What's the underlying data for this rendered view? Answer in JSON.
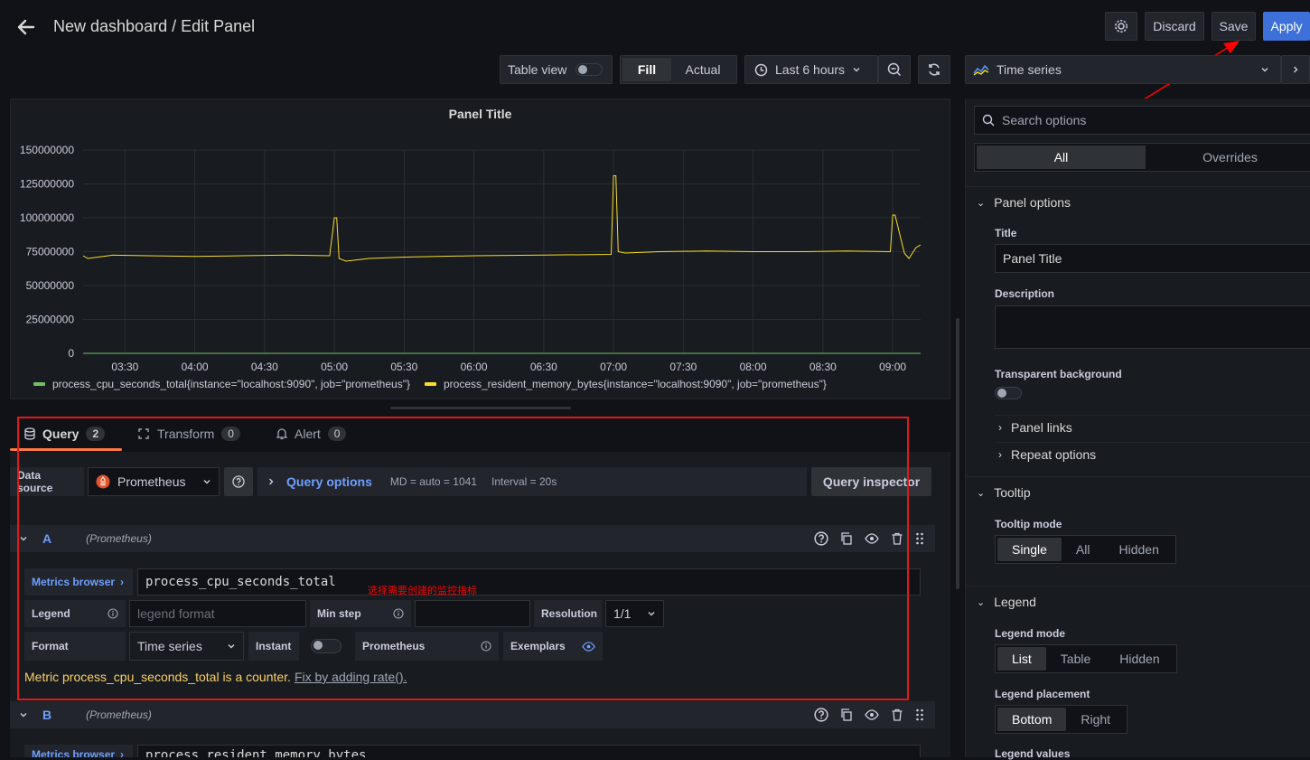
{
  "header": {
    "title": "New dashboard / Edit Panel",
    "discard": "Discard",
    "save": "Save",
    "apply": "Apply"
  },
  "toolbar": {
    "table_view": "Table view",
    "fill": "Fill",
    "actual": "Actual",
    "time_range": "Last 6 hours"
  },
  "panel": {
    "title": "Panel Title"
  },
  "chart_data": {
    "type": "line",
    "title": "",
    "yticks": [
      "150000000",
      "125000000",
      "100000000",
      "75000000",
      "50000000",
      "25000000",
      "0"
    ],
    "ylim": [
      0,
      150000000
    ],
    "xticks": [
      "03:30",
      "04:00",
      "04:30",
      "05:00",
      "05:30",
      "06:00",
      "06:30",
      "07:00",
      "07:30",
      "08:00",
      "08:30",
      "09:00"
    ],
    "grid": true,
    "legend_placement": "bottom",
    "series": [
      {
        "name": "process_cpu_seconds_total{instance=\"localhost:9090\", job=\"prometheus\"}",
        "color": "#73bf69",
        "x": [
          "03:12",
          "09:12"
        ],
        "values": [
          0,
          0
        ]
      },
      {
        "name": "process_resident_memory_bytes{instance=\"localhost:9090\", job=\"prometheus\"}",
        "color": "#fade2a",
        "x": [
          "03:12",
          "03:14",
          "03:25",
          "03:40",
          "04:00",
          "04:20",
          "04:40",
          "04:58",
          "05:00",
          "05:01",
          "05:02",
          "05:05",
          "05:15",
          "05:30",
          "06:00",
          "06:30",
          "06:59",
          "07:00",
          "07:01",
          "07:02",
          "07:05",
          "07:20",
          "07:40",
          "08:00",
          "08:20",
          "08:40",
          "08:59",
          "09:00",
          "09:01",
          "09:05",
          "09:07",
          "09:10",
          "09:12"
        ],
        "values": [
          72000000,
          70000000,
          72500000,
          72000000,
          71500000,
          72000000,
          72500000,
          72000000,
          100000000,
          100000000,
          70000000,
          68000000,
          70000000,
          71000000,
          72000000,
          72500000,
          73000000,
          131000000,
          131000000,
          75000000,
          74000000,
          75000000,
          75500000,
          75000000,
          75000000,
          75500000,
          75000000,
          102000000,
          102000000,
          74000000,
          70000000,
          78000000,
          80000000
        ]
      }
    ]
  },
  "query_tabs": [
    {
      "label": "Query",
      "count": "2"
    },
    {
      "label": "Transform",
      "count": "0"
    },
    {
      "label": "Alert",
      "count": "0"
    }
  ],
  "datasource": {
    "label": "Data source",
    "value": "Prometheus",
    "query_options": "Query options",
    "md": "MD = auto = 1041",
    "interval": "Interval = 20s",
    "inspector": "Query inspector"
  },
  "query_a": {
    "letter": "A",
    "source": "(Prometheus)",
    "metrics_browser": "Metrics browser",
    "expr": "process_cpu_seconds_total",
    "annotation": "选择需要创建的监控指标",
    "legend_label": "Legend",
    "legend_placeholder": "legend format",
    "min_step": "Min step",
    "resolution": "Resolution",
    "resolution_value": "1/1",
    "format": "Format",
    "format_value": "Time series",
    "instant": "Instant",
    "prometheus": "Prometheus",
    "exemplars": "Exemplars",
    "warning": "Metric process_cpu_seconds_total is a counter.",
    "fix": "Fix by adding rate()."
  },
  "query_b": {
    "letter": "B",
    "source": "(Prometheus)",
    "metrics_browser": "Metrics browser",
    "expr": "process_resident_memory_bytes"
  },
  "options": {
    "viz": "Time series",
    "search_placeholder": "Search options",
    "tab_all": "All",
    "tab_overrides": "Overrides",
    "panel_options": "Panel options",
    "title_label": "Title",
    "title_value": "Panel Title",
    "description_label": "Description",
    "transparent_label": "Transparent background",
    "panel_links": "Panel links",
    "repeat_options": "Repeat options",
    "tooltip": "Tooltip",
    "tooltip_mode": "Tooltip mode",
    "tooltip_opts": [
      "Single",
      "All",
      "Hidden"
    ],
    "legend": "Legend",
    "legend_mode": "Legend mode",
    "legend_mode_opts": [
      "List",
      "Table",
      "Hidden"
    ],
    "legend_placement": "Legend placement",
    "legend_placement_opts": [
      "Bottom",
      "Right"
    ],
    "legend_values": "Legend values"
  },
  "colors": {
    "apply": "#3d71d9",
    "accent": "#6e9fff",
    "annotation": "#ff0000",
    "warning": "#f8d06b"
  }
}
